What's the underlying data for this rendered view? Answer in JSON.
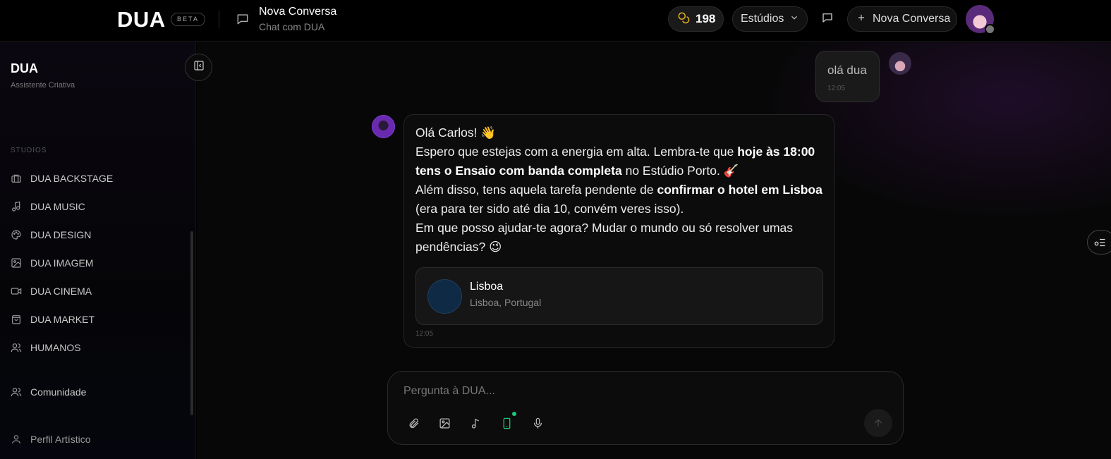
{
  "header": {
    "logo": "DUA",
    "badge": "BETA",
    "conversation_title": "Nova Conversa",
    "conversation_subtitle": "Chat com DUA",
    "credits": "198",
    "studios_label": "Estúdios",
    "new_conversation_label": "Nova Conversa"
  },
  "sidebar": {
    "title": "DUA",
    "subtitle": "Assistente Criativa",
    "section_label": "STUDIOS",
    "items": [
      {
        "label": "DUA BACKSTAGE",
        "icon": "briefcase-icon"
      },
      {
        "label": "DUA MUSIC",
        "icon": "music-icon"
      },
      {
        "label": "DUA DESIGN",
        "icon": "palette-icon"
      },
      {
        "label": "DUA IMAGEM",
        "icon": "image-icon"
      },
      {
        "label": "DUA CINEMA",
        "icon": "video-icon"
      },
      {
        "label": "DUA MARKET",
        "icon": "shopping-bag-icon"
      },
      {
        "label": "HUMANOS",
        "icon": "users-icon"
      }
    ],
    "community_label": "Comunidade",
    "profile_label": "Perfil Artístico"
  },
  "messages": {
    "user": {
      "text": "olá dua",
      "time": "12:05"
    },
    "assistant": {
      "greeting": "Olá Carlos! 👋",
      "p1_a": "Espero que estejas com a energia em alta. Lembra-te que ",
      "p1_bold": "hoje às 18:00 tens o Ensaio com banda completa",
      "p1_b": " no Estúdio Porto. 🎸",
      "p2_a": "Além disso, tens aquela tarefa pendente de ",
      "p2_bold": "confirmar o hotel em Lisboa",
      "p2_b": " (era para ter sido até dia 10, convém veres isso).",
      "p3": "Em que posso ajudar-te agora? Mudar o mundo ou só resolver umas pendências? 😉",
      "location_name": "Lisboa",
      "location_detail": "Lisboa, Portugal",
      "time": "12:05"
    }
  },
  "composer": {
    "placeholder": "Pergunta à DUA..."
  },
  "colors": {
    "accent_green": "#1ec87a",
    "credits_icon": "#e6b422"
  }
}
